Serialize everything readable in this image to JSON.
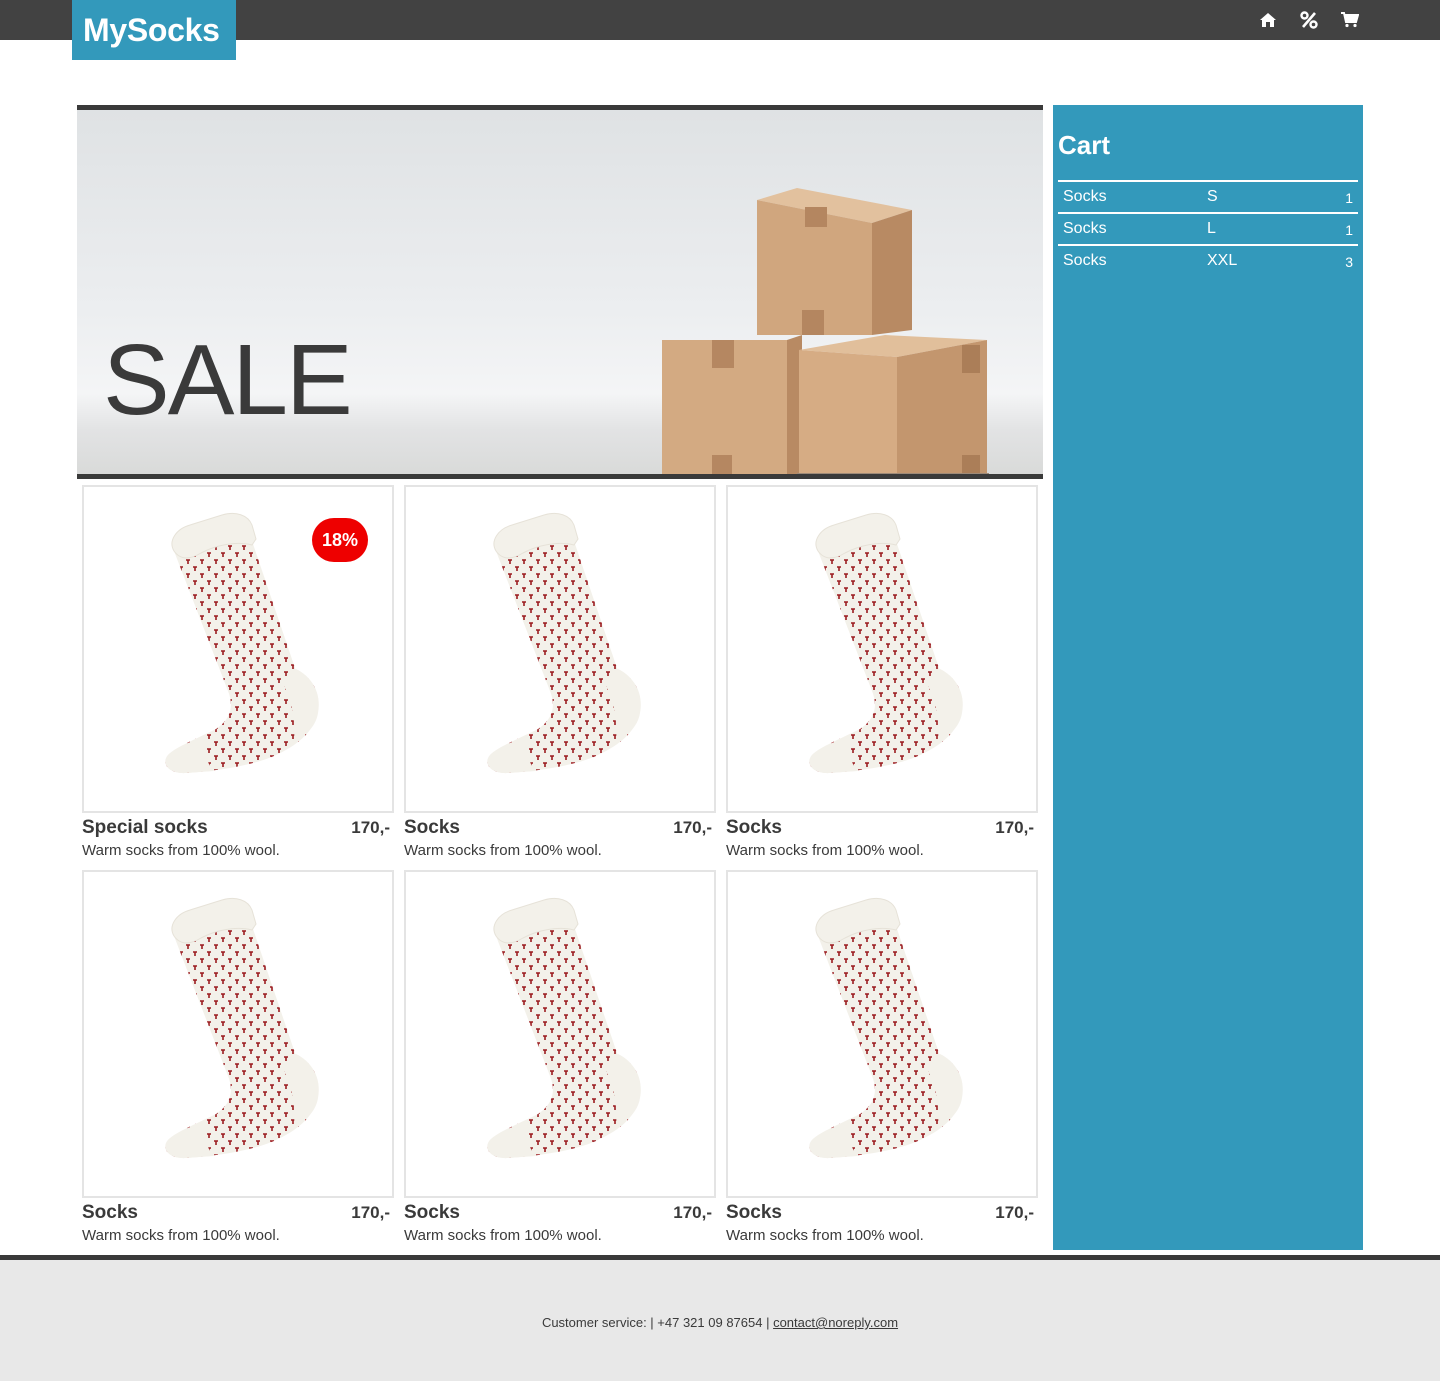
{
  "header": {
    "logo": "MySocks",
    "nav": [
      {
        "name": "home-icon",
        "label": "Home"
      },
      {
        "name": "percent-icon",
        "label": "Sale"
      },
      {
        "name": "cart-icon",
        "label": "Cart"
      }
    ],
    "bar_color": "#424242",
    "accent_color": "#3399bb"
  },
  "hero": {
    "title": "SALE"
  },
  "products": [
    {
      "name": "Special socks",
      "price": "170,-",
      "description": "Warm socks from 100% wool.",
      "badge": "18%"
    },
    {
      "name": "Socks",
      "price": "170,-",
      "description": "Warm socks from 100% wool."
    },
    {
      "name": "Socks",
      "price": "170,-",
      "description": "Warm socks from 100% wool."
    },
    {
      "name": "Socks",
      "price": "170,-",
      "description": "Warm socks from 100% wool."
    },
    {
      "name": "Socks",
      "price": "170,-",
      "description": "Warm socks from 100% wool."
    },
    {
      "name": "Socks",
      "price": "170,-",
      "description": "Warm socks from 100% wool."
    }
  ],
  "cart": {
    "title": "Cart",
    "items": [
      {
        "name": "Socks",
        "size": "S",
        "qty": "1"
      },
      {
        "name": "Socks",
        "size": "L",
        "qty": "1"
      },
      {
        "name": "Socks",
        "size": "XXL",
        "qty": "3"
      }
    ]
  },
  "footer": {
    "text": "Customer service: | +47 321 09 87654 | ",
    "email": "contact@noreply.com"
  },
  "colors": {
    "badge": "#ee0000",
    "sock_pattern": "#9b1b1f",
    "sock_base": "#f3f1ea"
  }
}
